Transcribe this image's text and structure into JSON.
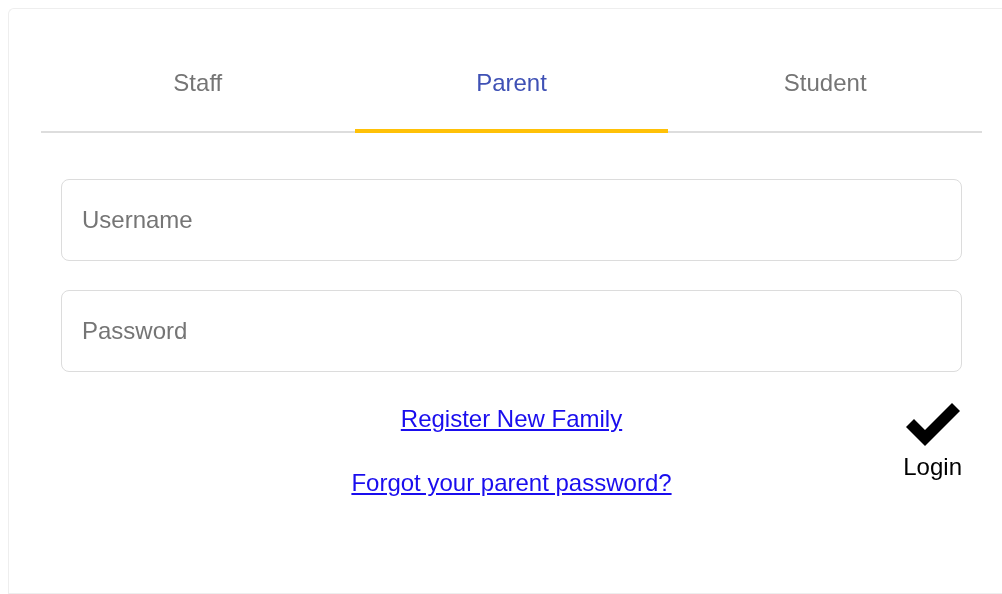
{
  "tabs": [
    {
      "label": "Staff",
      "selected": false
    },
    {
      "label": "Parent",
      "selected": true
    },
    {
      "label": "Student",
      "selected": false
    }
  ],
  "fields": [
    {
      "placeholder": "Username"
    },
    {
      "placeholder": "Password"
    }
  ],
  "links": [
    "Register New Family",
    "Forgot your parent password?"
  ],
  "login_button": {
    "label": "Login"
  }
}
